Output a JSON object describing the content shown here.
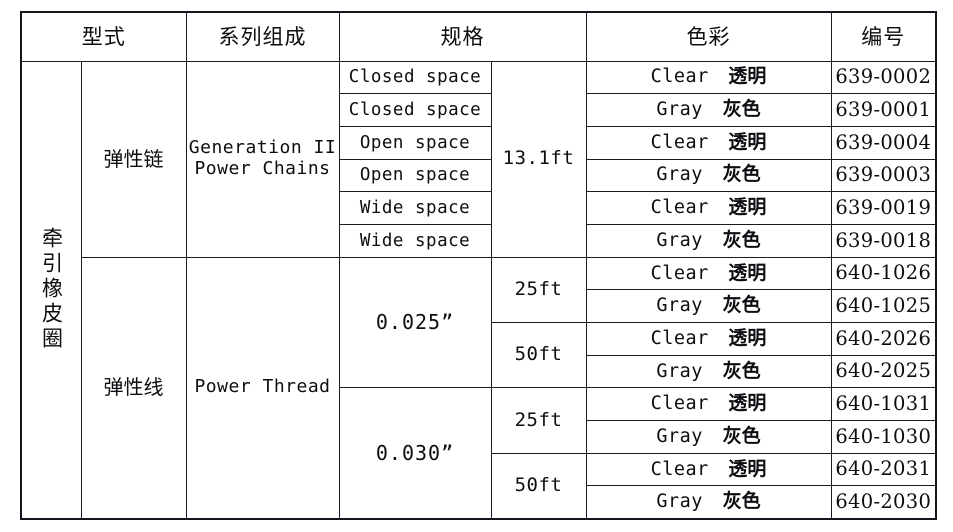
{
  "table": {
    "headers": {
      "type": "型式",
      "series": "系列组成",
      "spec": "规格",
      "color": "色彩",
      "number": "编号"
    },
    "category_label": "牵引橡皮圈",
    "groups": [
      {
        "type": "弹性链",
        "series_line1": "Generation II",
        "series_line2": "Power Chains",
        "length": "13.1ft",
        "rows": [
          {
            "spec": "Closed space",
            "color_en": "Clear",
            "color_cn": "透明",
            "number": "639-0002"
          },
          {
            "spec": "Closed space",
            "color_en": "Gray",
            "color_cn": "灰色",
            "number": "639-0001"
          },
          {
            "spec": "Open space",
            "color_en": "Clear",
            "color_cn": "透明",
            "number": "639-0004"
          },
          {
            "spec": "Open space",
            "color_en": "Gray",
            "color_cn": "灰色",
            "number": "639-0003"
          },
          {
            "spec": "Wide space",
            "color_en": "Clear",
            "color_cn": "透明",
            "number": "639-0019"
          },
          {
            "spec": "Wide space",
            "color_en": "Gray",
            "color_cn": "灰色",
            "number": "639-0018"
          }
        ]
      },
      {
        "type": "弹性线",
        "series_line1": "Power Thread",
        "series_line2": "",
        "sizes": [
          {
            "size": "0.025”",
            "lengths": [
              {
                "length": "25ft",
                "rows": [
                  {
                    "color_en": "Clear",
                    "color_cn": "透明",
                    "number": "640-1026"
                  },
                  {
                    "color_en": "Gray",
                    "color_cn": "灰色",
                    "number": "640-1025"
                  }
                ]
              },
              {
                "length": "50ft",
                "rows": [
                  {
                    "color_en": "Clear",
                    "color_cn": "透明",
                    "number": "640-2026"
                  },
                  {
                    "color_en": "Gray",
                    "color_cn": "灰色",
                    "number": "640-2025"
                  }
                ]
              }
            ]
          },
          {
            "size": "0.030”",
            "lengths": [
              {
                "length": "25ft",
                "rows": [
                  {
                    "color_en": "Clear",
                    "color_cn": "透明",
                    "number": "640-1031"
                  },
                  {
                    "color_en": "Gray",
                    "color_cn": "灰色",
                    "number": "640-1030"
                  }
                ]
              },
              {
                "length": "50ft",
                "rows": [
                  {
                    "color_en": "Clear",
                    "color_cn": "透明",
                    "number": "640-2031"
                  },
                  {
                    "color_en": "Gray",
                    "color_cn": "灰色",
                    "number": "640-2030"
                  }
                ]
              }
            ]
          }
        ]
      }
    ]
  }
}
